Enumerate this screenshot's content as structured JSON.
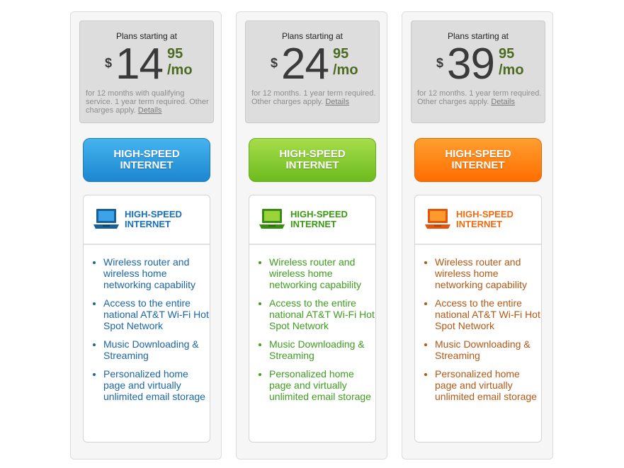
{
  "plans": [
    {
      "starting_label": "Plans starting at",
      "currency": "$",
      "dollars": "14",
      "cents": "95",
      "per": "/mo",
      "terms": "for 12 months with qualifying service. 1 year term required. Other charges apply.",
      "details_link": "Details",
      "button_label_line1": "HIGH-SPEED",
      "button_label_line2": "INTERNET",
      "card_title_line1": "HIGH-SPEED",
      "card_title_line2": "INTERNET",
      "icon": "laptop-icon",
      "accent_color": "#1570b7",
      "features": [
        "Wireless router and wireless home networking capability",
        "Access to the entire national AT&T Wi-Fi Hot Spot Network",
        "Music Downloading & Streaming",
        "Personalized home page and virtually unlimited email storage"
      ]
    },
    {
      "starting_label": "Plans starting at",
      "currency": "$",
      "dollars": "24",
      "cents": "95",
      "per": "/mo",
      "terms": "for 12 months. 1 year term required. Other charges apply.",
      "details_link": "Details",
      "button_label_line1": "HIGH-SPEED",
      "button_label_line2": "INTERNET",
      "card_title_line1": "HIGH-SPEED",
      "card_title_line2": "INTERNET",
      "icon": "laptop-icon",
      "accent_color": "#3a9a13",
      "features": [
        "Wireless router and wireless home networking capability",
        "Access to the entire national AT&T Wi-Fi Hot Spot Network",
        "Music Downloading & Streaming",
        "Personalized home page and virtually unlimited email storage"
      ]
    },
    {
      "starting_label": "Plans starting at",
      "currency": "$",
      "dollars": "39",
      "cents": "95",
      "per": "/mo",
      "terms": "for 12 months. 1 year term required. Other charges apply.",
      "details_link": "Details",
      "button_label_line1": "HIGH-SPEED",
      "button_label_line2": "INTERNET",
      "card_title_line1": "HIGH-SPEED",
      "card_title_line2": "INTERNET",
      "icon": "laptop-icon",
      "accent_color": "#ef6a10",
      "features": [
        "Wireless router and wireless home networking capability",
        "Access to the entire national AT&T Wi-Fi Hot Spot Network",
        "Music Downloading & Streaming",
        "Personalized home page and virtually unlimited email storage"
      ]
    }
  ]
}
